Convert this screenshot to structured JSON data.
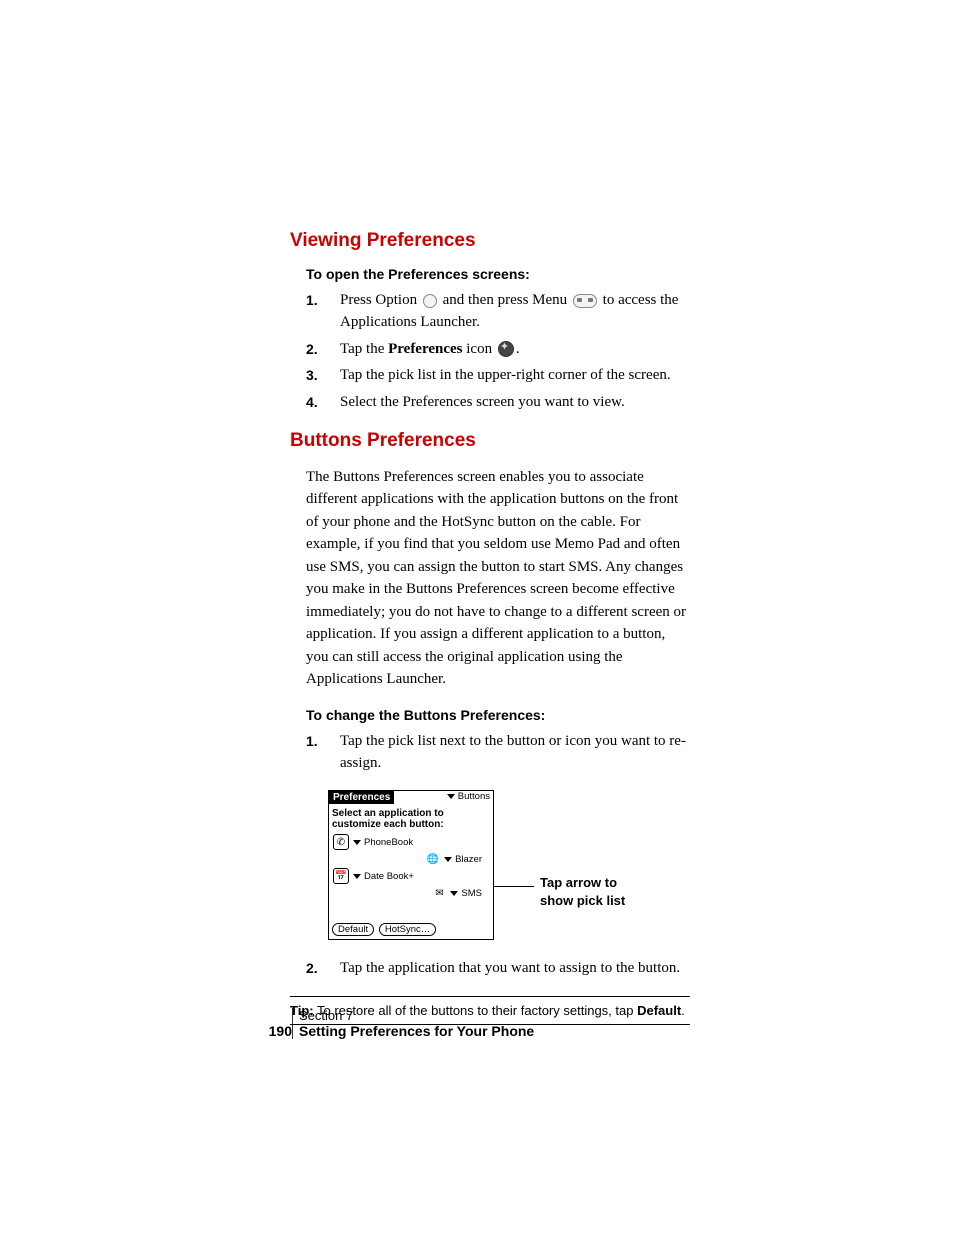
{
  "h1_viewing": "Viewing Preferences",
  "sub_open": "To open the Preferences screens:",
  "steps_open": {
    "s1": {
      "num": "1.",
      "pre": "Press Option ",
      "mid": " and then press Menu ",
      "post": " to access the Applications Launcher."
    },
    "s2": {
      "num": "2.",
      "pre": "Tap the ",
      "bold": "Preferences",
      "mid": " icon ",
      "post": "."
    },
    "s3": {
      "num": "3.",
      "text": "Tap the pick list in the upper-right corner of the screen."
    },
    "s4": {
      "num": "4.",
      "text": "Select the Preferences screen you want to view."
    }
  },
  "h1_buttons": "Buttons Preferences",
  "buttons_para": "The Buttons Preferences screen enables you to associate different applications with the application buttons on the front of your phone and the HotSync button on the cable. For example, if you find that you seldom use Memo Pad and often use SMS, you can assign the button to start SMS. Any changes you make in the Buttons Preferences screen become effective immediately; you do not have to change to a different screen or application. If you assign a different application to a button, you can still access the original application using the Applications Launcher.",
  "sub_change": "To change the Buttons Preferences:",
  "steps_change": {
    "s1": {
      "num": "1.",
      "text": "Tap the pick list next to the button or icon you want to re-assign."
    },
    "s2": {
      "num": "2.",
      "text": "Tap the application that you want to assign to the button."
    }
  },
  "palm": {
    "title": "Preferences",
    "picklist": "Buttons",
    "instruct": "Select an application to customize each button:",
    "row1": "PhoneBook",
    "row2": "Blazer",
    "row3": "Date Book+",
    "row4": "SMS",
    "btn_default": "Default",
    "btn_hotsync": "HotSync…"
  },
  "callout": "Tap arrow to show pick list",
  "tip": {
    "label": "Tip:",
    "text": " To restore all of the buttons to their factory settings, tap ",
    "bold": "Default",
    "post": "."
  },
  "footer": {
    "section": "Section 7",
    "page": "190",
    "chapter": "Setting Preferences for Your Phone"
  }
}
